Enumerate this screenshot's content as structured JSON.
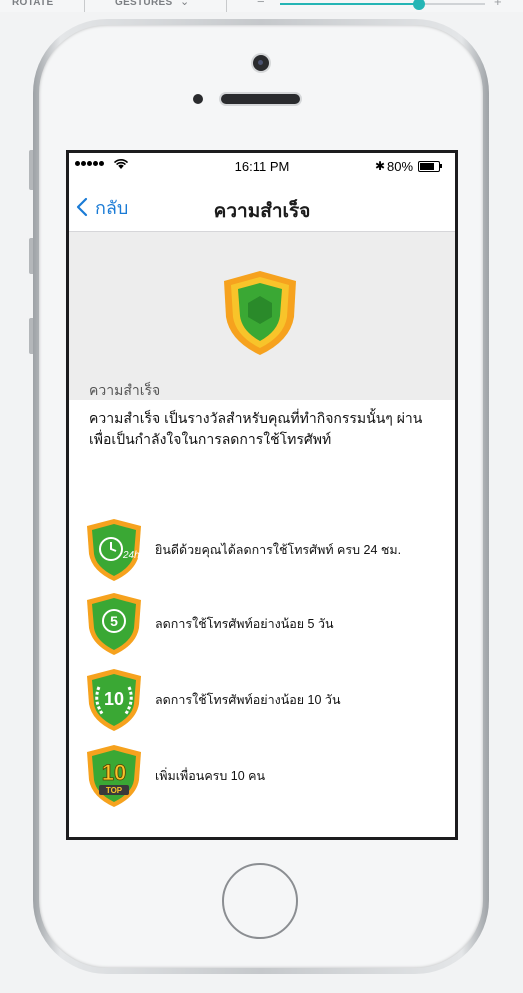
{
  "toolbar": {
    "rotate_label": "ROTATE",
    "gestures_label": "GESTURES",
    "zoom_minus": "−",
    "zoom_plus": "+",
    "zoom_level": 0.68
  },
  "status_bar": {
    "time": "16:11 PM",
    "bluetooth": "bluetooth-icon",
    "battery_percent": "80%",
    "battery_level": 0.8
  },
  "nav": {
    "back_label": "กลับ",
    "title": "ความสำเร็จ"
  },
  "hero": {
    "section_label": "ความสำเร็จ"
  },
  "description": "ความสำเร็จ เป็นรางวัลสำหรับคุณที่ทำกิจกรรมนั้นๆ ผ่าน เพื่อเป็นกำลังใจในการลดการใช้โทรศัพท์",
  "achievements": [
    {
      "badge_text": "24h",
      "label": "ยินดีด้วยคุณได้ลดการใช้โทรศัพท์ ครบ 24 ชม.",
      "icon": "clock-24h-badge-icon"
    },
    {
      "badge_text": "5",
      "label": "ลดการใช้โทรศัพท์อย่างน้อย 5 วัน",
      "icon": "five-days-badge-icon"
    },
    {
      "badge_text": "10",
      "label": "ลดการใช้โทรศัพท์อย่างน้อย 10 วัน",
      "icon": "ten-days-laurel-badge-icon"
    },
    {
      "badge_text": "10",
      "badge_subtext": "TOP",
      "label": "เพิ่มเพื่อนครบ 10 คน",
      "icon": "top-10-badge-icon"
    }
  ],
  "colors": {
    "accent_blue": "#1a7bd6",
    "shield_orange": "#f6a21e",
    "shield_yellow": "#f8c42a",
    "shield_green": "#3aa834",
    "shield_green_dark": "#2a8a2a",
    "slider_teal": "#25b5b5"
  }
}
